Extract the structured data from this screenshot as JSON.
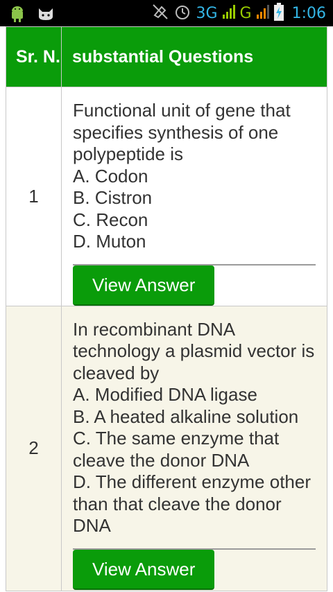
{
  "status_bar": {
    "network_1": "3G",
    "network_2": "G",
    "time": "1:06"
  },
  "table": {
    "headers": {
      "serial": "Sr. N.",
      "questions": "substantial Questions"
    },
    "rows": [
      {
        "number": "1",
        "question": "Functional unit of gene that specifies synthesis of one polypeptide is",
        "options": [
          "A. Codon",
          "B. Cistron",
          "C. Recon",
          "D. Muton"
        ],
        "button": "View Answer"
      },
      {
        "number": "2",
        "question": "In recombinant DNA technology a plasmid vector is cleaved by",
        "options": [
          "A. Modified DNA ligase",
          "B. A heated alkaline solution",
          "C. The same enzyme that cleave the donor DNA",
          "D. The different enzyme other than that cleave the donor DNA"
        ],
        "button": "View Answer"
      }
    ]
  },
  "colors": {
    "header_green": "#0a9c0a",
    "status_blue": "#33b5e5",
    "row_alt": "#f7f5e8"
  },
  "icons": [
    "android-icon",
    "cat-icon",
    "mute-icon",
    "alarm-icon",
    "signal-icon",
    "battery-charging-icon"
  ]
}
